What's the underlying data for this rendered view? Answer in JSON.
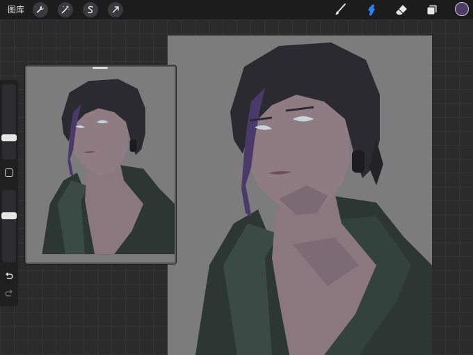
{
  "topbar": {
    "gallery_label": "图库",
    "tools_left": [
      "wrench-icon",
      "magic-wand-icon",
      "selection-s-icon",
      "transform-arrow-icon"
    ],
    "tools_right": [
      "brush-icon",
      "smudge-icon",
      "eraser-icon",
      "layers-icon"
    ],
    "active_tool": "smudge-icon",
    "accent_color": "#2f7ff0",
    "current_color": "#4b3d63"
  },
  "sidebar": {
    "controls": [
      "brush-size-slider",
      "modify-button",
      "opacity-slider",
      "undo-icon",
      "redo-icon"
    ]
  },
  "colors": {
    "background": "#2b2b2c",
    "canvas_gray": "#7c7c7c",
    "hair": "#2a2a30",
    "skin": "#8d7a80",
    "jacket": "#2c3733",
    "face_paint": "#4a3a6a"
  }
}
